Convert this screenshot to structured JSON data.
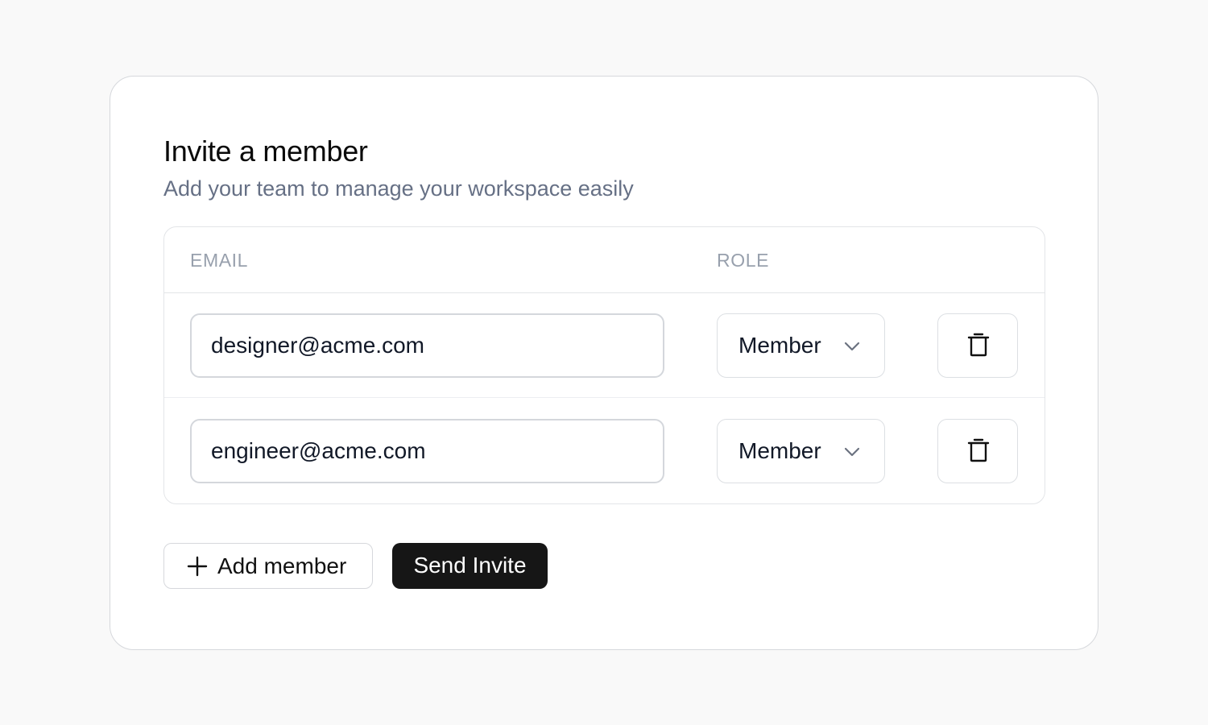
{
  "header": {
    "title": "Invite a member",
    "subtitle": "Add your team to manage your workspace easily"
  },
  "table": {
    "columns": {
      "email": "EMAIL",
      "role": "ROLE"
    },
    "rows": [
      {
        "email": "designer@acme.com",
        "role": "Member"
      },
      {
        "email": "engineer@acme.com",
        "role": "Member"
      }
    ]
  },
  "icons": {
    "chevron": "chevron-down-icon",
    "delete": "trash-icon",
    "add": "plus-icon"
  },
  "actions": {
    "add_label": "Add member",
    "send_label": "Send Invite"
  },
  "colors": {
    "primary_button": "#161616",
    "subtitle": "#667085",
    "column_header": "#98a0ad"
  }
}
